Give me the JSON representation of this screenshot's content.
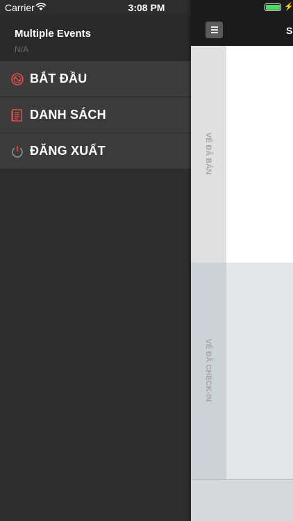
{
  "status_bar": {
    "carrier": "Carrier",
    "time": "3:08 PM",
    "battery_level": 1.0,
    "wifi_icon": "wifi-icon",
    "battery_icon": "battery-icon"
  },
  "menu": {
    "title": "Multiple Events",
    "subtitle": "N/A",
    "items": [
      {
        "label": "BẮT ĐẦU",
        "icon": "start-icon",
        "icon_color": "#e8504c"
      },
      {
        "label": "DANH SÁCH",
        "icon": "list-icon",
        "icon_color": "#e8504c"
      },
      {
        "label": "ĐĂNG XUẤT",
        "icon": "power-icon",
        "icon_color": "#9a9a9a"
      }
    ]
  },
  "main": {
    "nav_title": "Su",
    "hamburger_icon": "hamburger-icon",
    "panels": [
      {
        "label": "VÉ ĐÃ BÁN"
      },
      {
        "label": "VÉ ĐÃ CHECK-IN"
      }
    ]
  },
  "colors": {
    "menu_bg": "#2d2d2d",
    "menu_item_bg": "#3b3b3b",
    "accent": "#e8504c",
    "nav_bg": "#1b1b1b"
  }
}
